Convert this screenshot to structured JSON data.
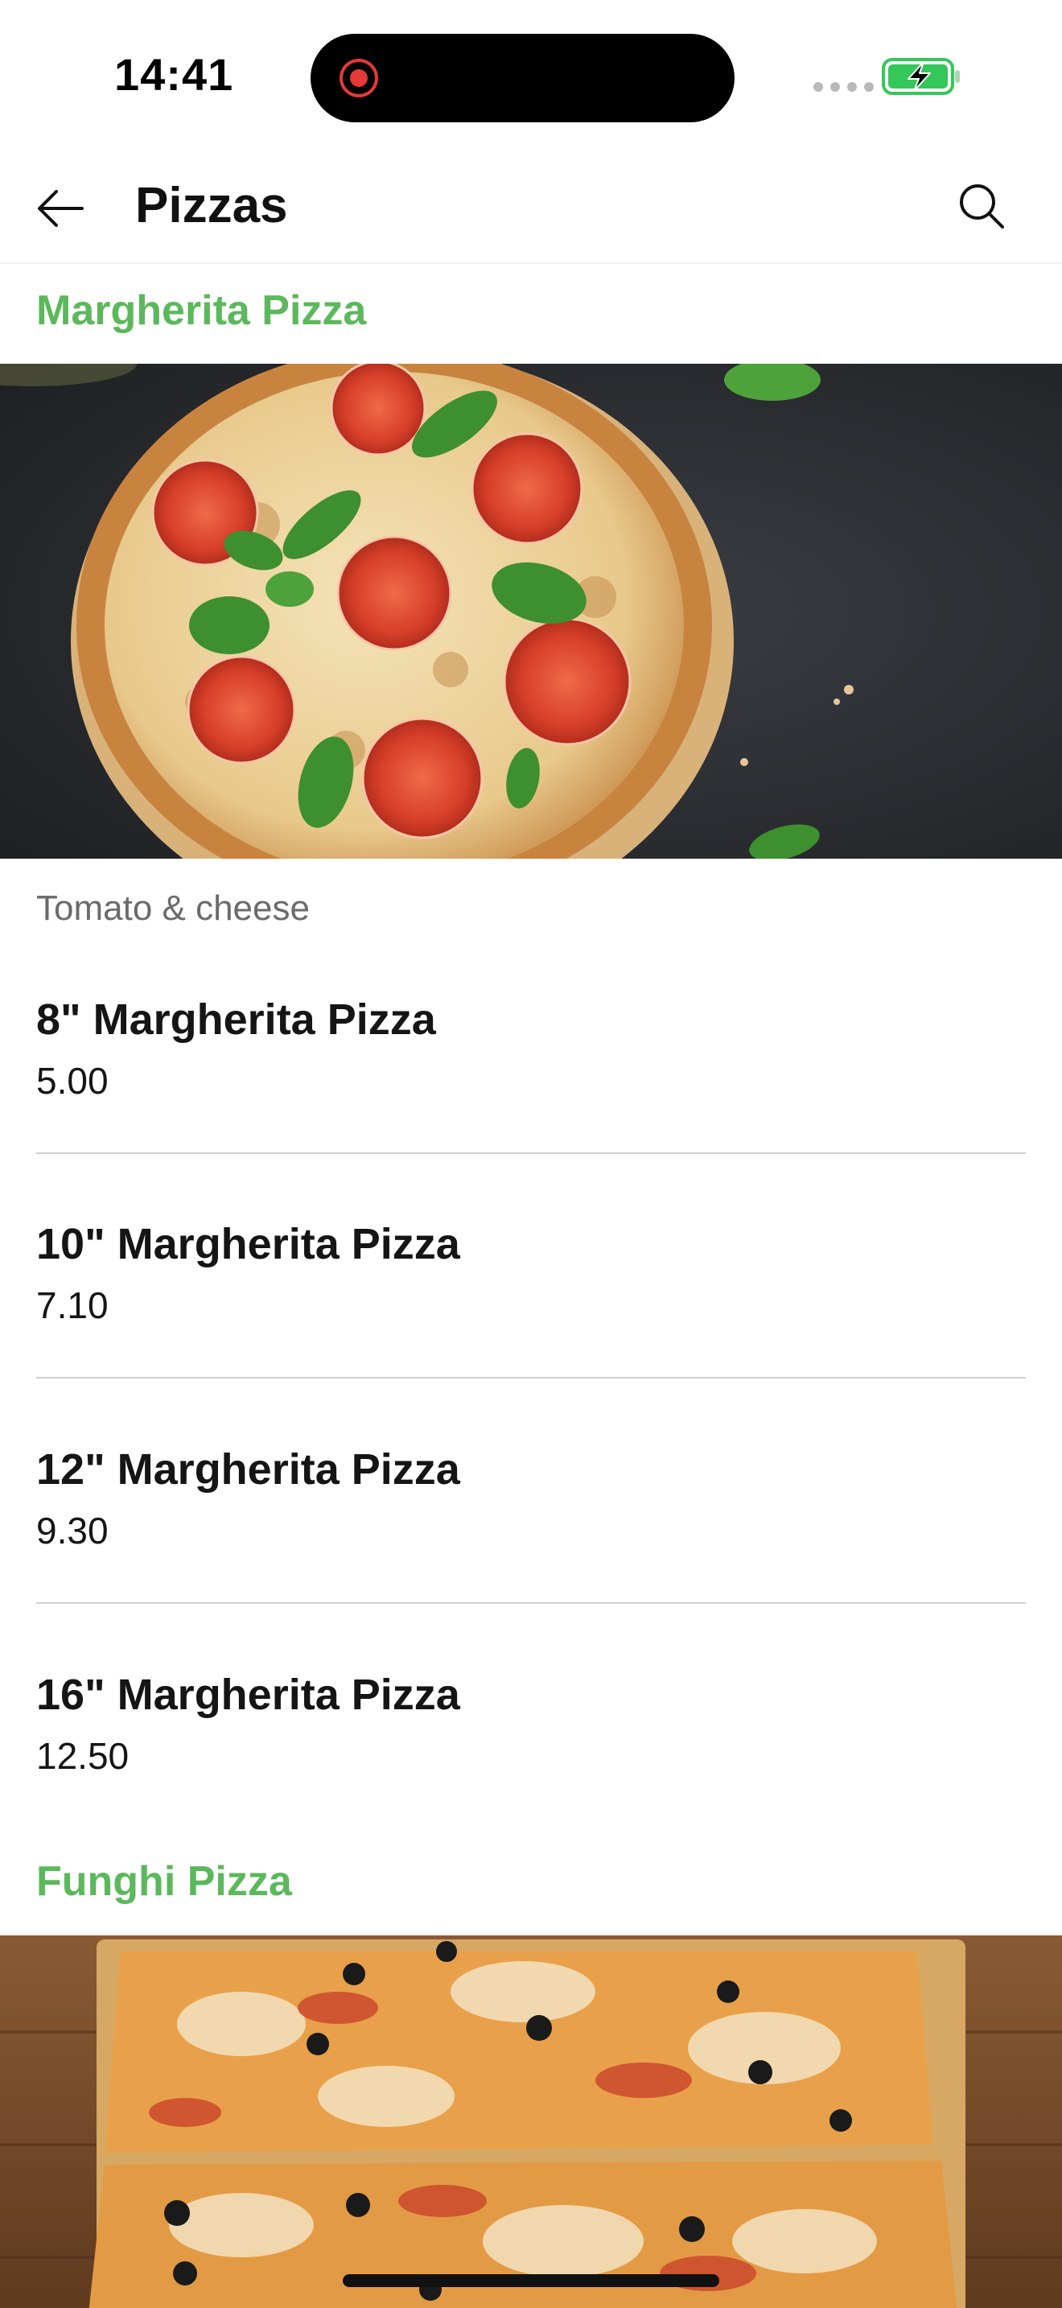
{
  "status_bar": {
    "time": "14:41"
  },
  "header": {
    "title": "Pizzas",
    "back_icon": "arrow-left-icon",
    "search_icon": "search-icon"
  },
  "categories": [
    {
      "title": "Margherita Pizza",
      "description": "Tomato & cheese",
      "items": [
        {
          "name": "8\" Margherita Pizza",
          "price": "5.00"
        },
        {
          "name": "10\" Margherita Pizza",
          "price": "7.10"
        },
        {
          "name": "12\" Margherita Pizza",
          "price": "9.30"
        },
        {
          "name": "16\" Margherita Pizza",
          "price": "12.50"
        }
      ]
    },
    {
      "title": "Funghi Pizza"
    }
  ],
  "colors": {
    "accent": "#5cb85c",
    "divider": "#cfcfcf",
    "battery_green": "#34c759",
    "record_red": "#e53935"
  }
}
